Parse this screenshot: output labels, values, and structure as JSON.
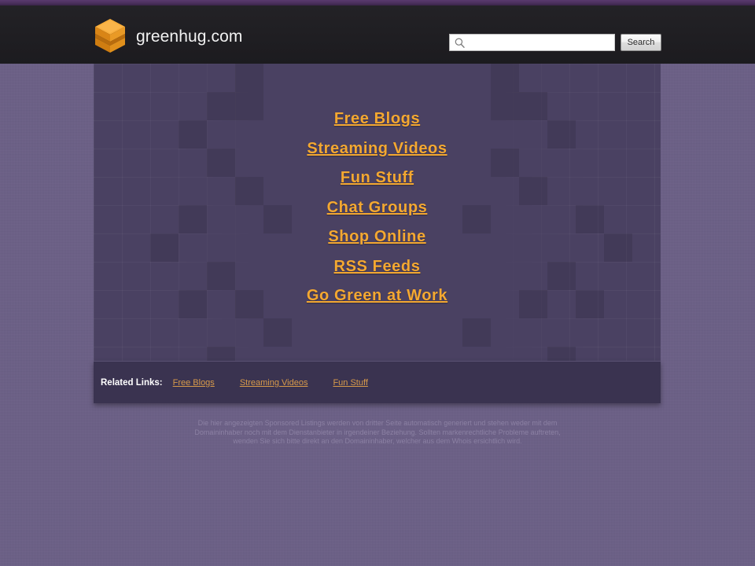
{
  "header": {
    "logo_icon": "orange-cube-logo",
    "brand_title": "greenhug.com",
    "search": {
      "icon": "search-icon",
      "value": "",
      "placeholder": "",
      "button_label": "Search"
    }
  },
  "main": {
    "links": [
      {
        "label": "Free Blogs"
      },
      {
        "label": "Streaming Videos"
      },
      {
        "label": "Fun Stuff"
      },
      {
        "label": "Chat Groups"
      },
      {
        "label": "Shop Online"
      },
      {
        "label": "RSS Feeds"
      },
      {
        "label": "Go Green at Work"
      }
    ]
  },
  "related": {
    "label": "Related Links:",
    "links": [
      {
        "label": "Free Blogs"
      },
      {
        "label": "Streaming Videos"
      },
      {
        "label": "Fun Stuff"
      }
    ]
  },
  "disclaimer": {
    "text": "Die hier angezeigten Sponsored Listings werden von dritter Seite automatisch generiert und stehen weder mit dem Domaininhaber noch mit dem Dienstanbieter in irgendeiner Beziehung. Sollten markenrechtliche Probleme auftreten, wenden Sie sich bitte direkt an den Domaininhaber, welcher aus dem Whois ersichtlich wird."
  },
  "colors": {
    "page_background": "#6b5f86",
    "header_background": "#1e1d21",
    "top_stripe": "#4a2f5c",
    "content_panel": "#4a4162",
    "related_bar": "#3a3350",
    "link_orange": "#f4a831",
    "related_link_orange": "#d79a4a",
    "logo_orange": "#f5a623",
    "disclaimer_text": "#8b80a3"
  }
}
